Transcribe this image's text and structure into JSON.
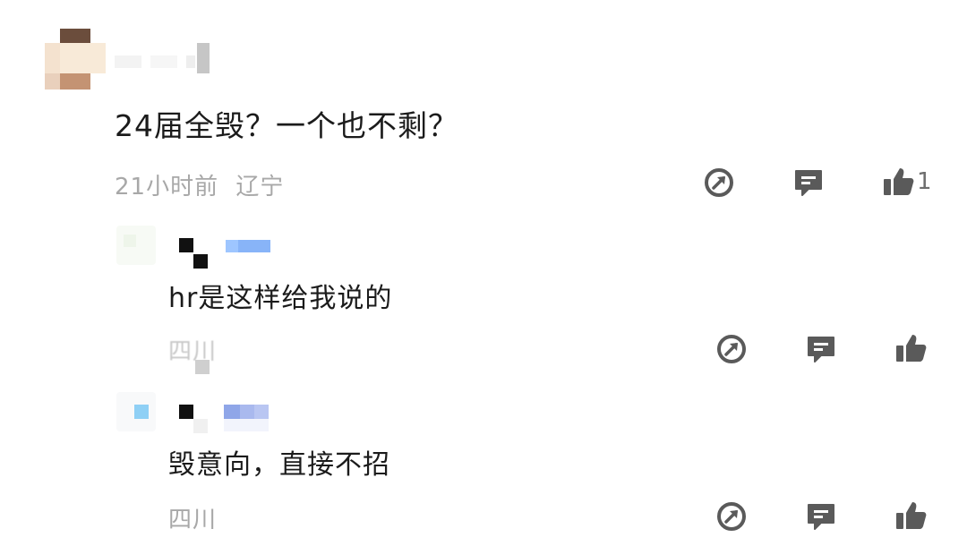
{
  "comment": {
    "text": "24届全毁？一个也不剩？",
    "time": "21小时前",
    "location": "辽宁",
    "like_count": "1",
    "actions": {
      "share_icon": "share-icon",
      "reply_icon": "reply-icon",
      "like_icon": "thumbs-up-icon"
    }
  },
  "replies": [
    {
      "text": "hr是这样给我说的",
      "location": "四川",
      "actions": {
        "share_icon": "share-icon",
        "reply_icon": "reply-icon",
        "like_icon": "thumbs-up-icon"
      }
    },
    {
      "text": "毁意向，直接不招",
      "location": "四川",
      "actions": {
        "share_icon": "share-icon",
        "reply_icon": "reply-icon",
        "like_icon": "thumbs-up-icon"
      }
    }
  ],
  "colors": {
    "icon": "#5a5a5a",
    "meta": "#a8a8a8",
    "text": "#1b1b1b"
  }
}
